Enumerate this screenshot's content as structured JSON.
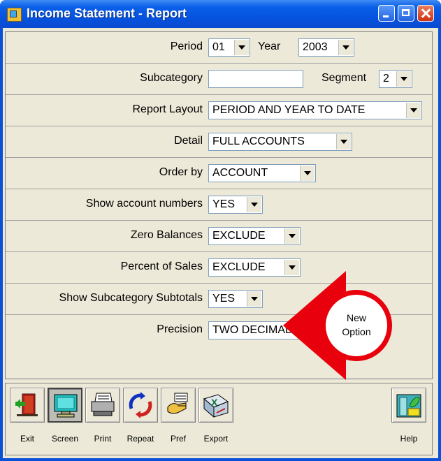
{
  "window": {
    "title": "Income Statement - Report"
  },
  "form": {
    "period": {
      "label": "Period",
      "value": "01"
    },
    "year": {
      "label": "Year",
      "value": "2003"
    },
    "subcategory": {
      "label": "Subcategory",
      "value": ""
    },
    "segment": {
      "label": "Segment",
      "value": "2"
    },
    "report_layout": {
      "label": "Report Layout",
      "value": "PERIOD AND YEAR TO DATE"
    },
    "detail": {
      "label": "Detail",
      "value": "FULL ACCOUNTS"
    },
    "order_by": {
      "label": "Order by",
      "value": "ACCOUNT"
    },
    "show_account_numbers": {
      "label": "Show account numbers",
      "value": "YES"
    },
    "zero_balances": {
      "label": "Zero Balances",
      "value": "EXCLUDE"
    },
    "percent_of_sales": {
      "label": "Percent of Sales",
      "value": "EXCLUDE"
    },
    "show_subcategory_subtotals": {
      "label": "Show Subcategory Subtotals",
      "value": "YES"
    },
    "precision": {
      "label": "Precision",
      "value": "TWO DECIMAL"
    }
  },
  "callout": {
    "line1": "New",
    "line2": "Option",
    "color": "#e8000c"
  },
  "toolbar": {
    "exit": "Exit",
    "screen": "Screen",
    "print": "Print",
    "repeat": "Repeat",
    "pref": "Pref",
    "export": "Export",
    "help": "Help"
  }
}
